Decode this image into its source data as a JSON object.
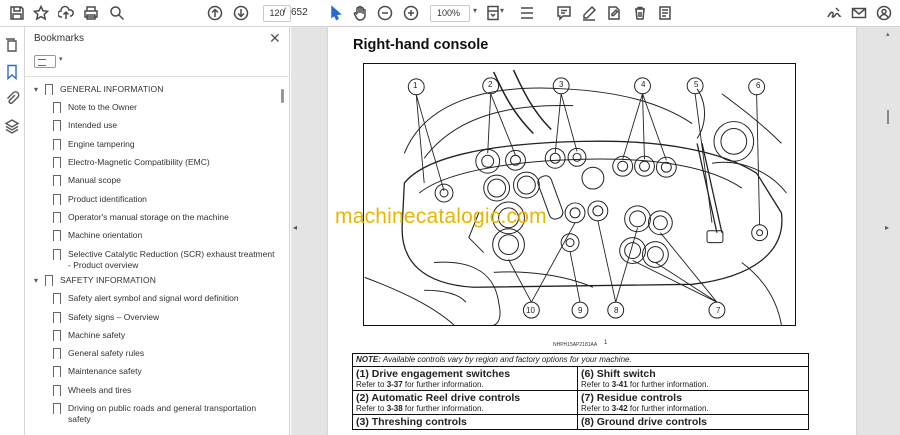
{
  "toolbar": {
    "page_current": "120",
    "page_separator": "/",
    "page_total": "652",
    "zoom": "100%",
    "icons": [
      "save-icon",
      "bookmark-star-icon",
      "upload-icon",
      "print-icon",
      "search-icon",
      "page-up-icon",
      "page-down-icon",
      "select-cursor-icon",
      "hand-icon",
      "zoom-out-icon",
      "zoom-in-icon",
      "fit-page-icon",
      "scroll-mode-icon",
      "comment-icon",
      "highlight-pen-icon",
      "edit-icon",
      "delete-icon",
      "sign-icon",
      "email-icon",
      "account-icon"
    ]
  },
  "rail": {
    "icons": [
      "pages-icon",
      "bookmark-icon",
      "attachment-icon",
      "layers-icon"
    ]
  },
  "bookmarks": {
    "title": "Bookmarks",
    "items": [
      {
        "label": "GENERAL INFORMATION",
        "section": true
      },
      {
        "label": "Note to the Owner"
      },
      {
        "label": "Intended use"
      },
      {
        "label": "Engine tampering"
      },
      {
        "label": "Electro-Magnetic Compatibility (EMC)"
      },
      {
        "label": "Manual scope"
      },
      {
        "label": "Product identification"
      },
      {
        "label": "Operator's manual storage on the machine"
      },
      {
        "label": "Machine orientation"
      },
      {
        "label": "Selective Catalytic Reduction (SCR) exhaust treatment - Product overview"
      },
      {
        "label": "SAFETY INFORMATION",
        "section": true
      },
      {
        "label": "Safety alert symbol and signal word definition"
      },
      {
        "label": "Safety signs – Overview"
      },
      {
        "label": "Machine safety"
      },
      {
        "label": "General safety rules"
      },
      {
        "label": "Maintenance safety"
      },
      {
        "label": "Wheels and tires"
      },
      {
        "label": "Driving on public roads and general transportation safety"
      }
    ]
  },
  "document": {
    "heading": "Right-hand console",
    "watermark": "machinecatalogic.com",
    "figure_code": "NHPH15AP2181AA",
    "figure_number": "1",
    "callouts": [
      "1",
      "2",
      "3",
      "4",
      "5",
      "6",
      "7",
      "8",
      "9",
      "10"
    ],
    "note_label": "NOTE:",
    "note_text": " Available controls vary by region and factory options for your machine.",
    "controls": [
      {
        "title": "(1) Drive engagement switches",
        "ref_pre": "Refer to ",
        "ref_page": "3-37",
        "ref_post": " for further information."
      },
      {
        "title": "(6) Shift switch",
        "ref_pre": "Refer to ",
        "ref_page": "3-41",
        "ref_post": " for further information."
      },
      {
        "title": "(2) Automatic Reel drive controls",
        "ref_pre": "Refer to ",
        "ref_page": "3-38",
        "ref_post": " for further information."
      },
      {
        "title": "(7) Residue controls",
        "ref_pre": "Refer to ",
        "ref_page": "3-42",
        "ref_post": " for further information."
      },
      {
        "title": "(3) Threshing controls"
      },
      {
        "title": "(8) Ground drive controls"
      }
    ]
  }
}
